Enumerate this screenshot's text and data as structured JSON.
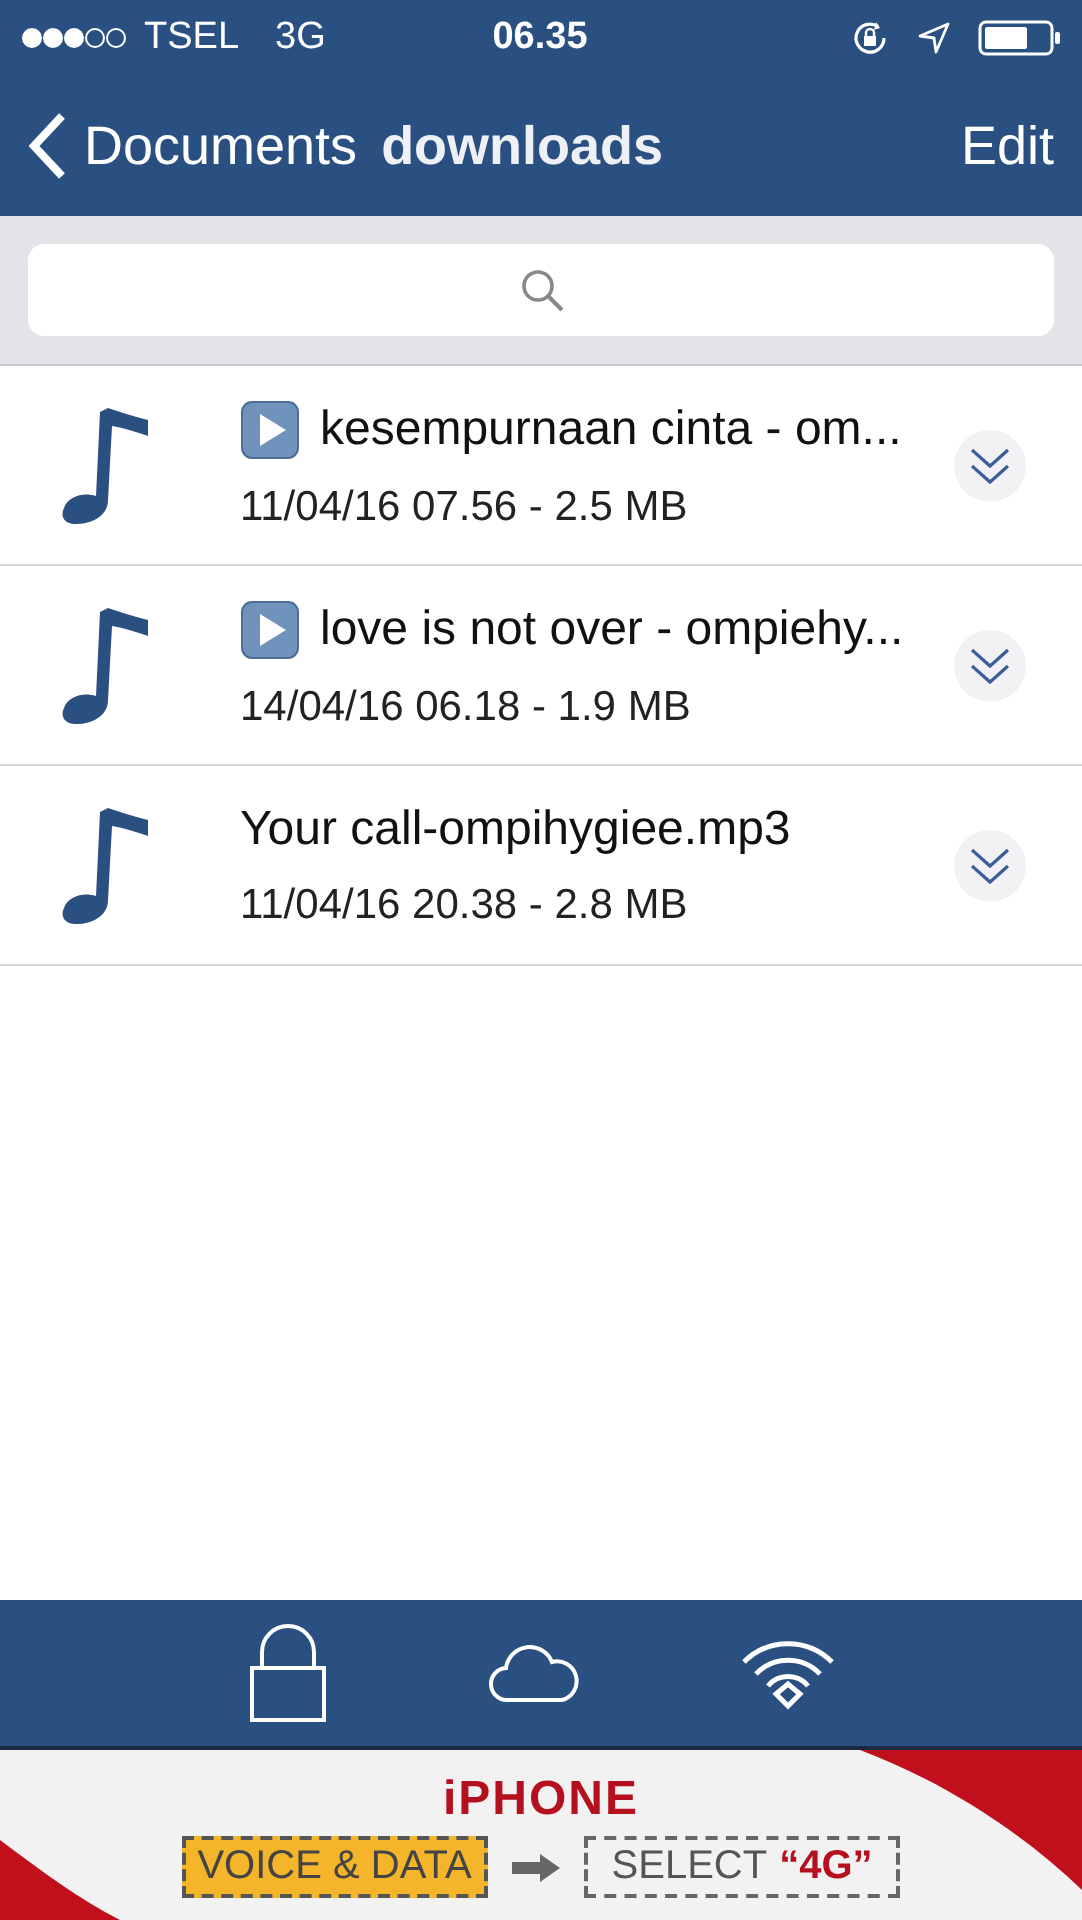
{
  "status_bar": {
    "carrier": "TSEL",
    "network": "3G",
    "time": "06.35"
  },
  "nav": {
    "back_label": "Documents",
    "title": "downloads",
    "action": "Edit"
  },
  "files": [
    {
      "name": "kesempurnaan cinta - om...",
      "play_badge": true,
      "meta": "11/04/16 07.56 - 2.5 MB"
    },
    {
      "name": "love is not over - ompiehy...",
      "play_badge": true,
      "meta": "14/04/16 06.18 - 1.9 MB"
    },
    {
      "name": "Your call-ompihygiee.mp3",
      "play_badge": false,
      "meta": "11/04/16 20.38 - 2.8 MB"
    }
  ],
  "banner": {
    "title": "iPHONE",
    "step_1": "VOICE & DATA",
    "step_2": "SELECT",
    "step_2_value": "“4G”"
  }
}
